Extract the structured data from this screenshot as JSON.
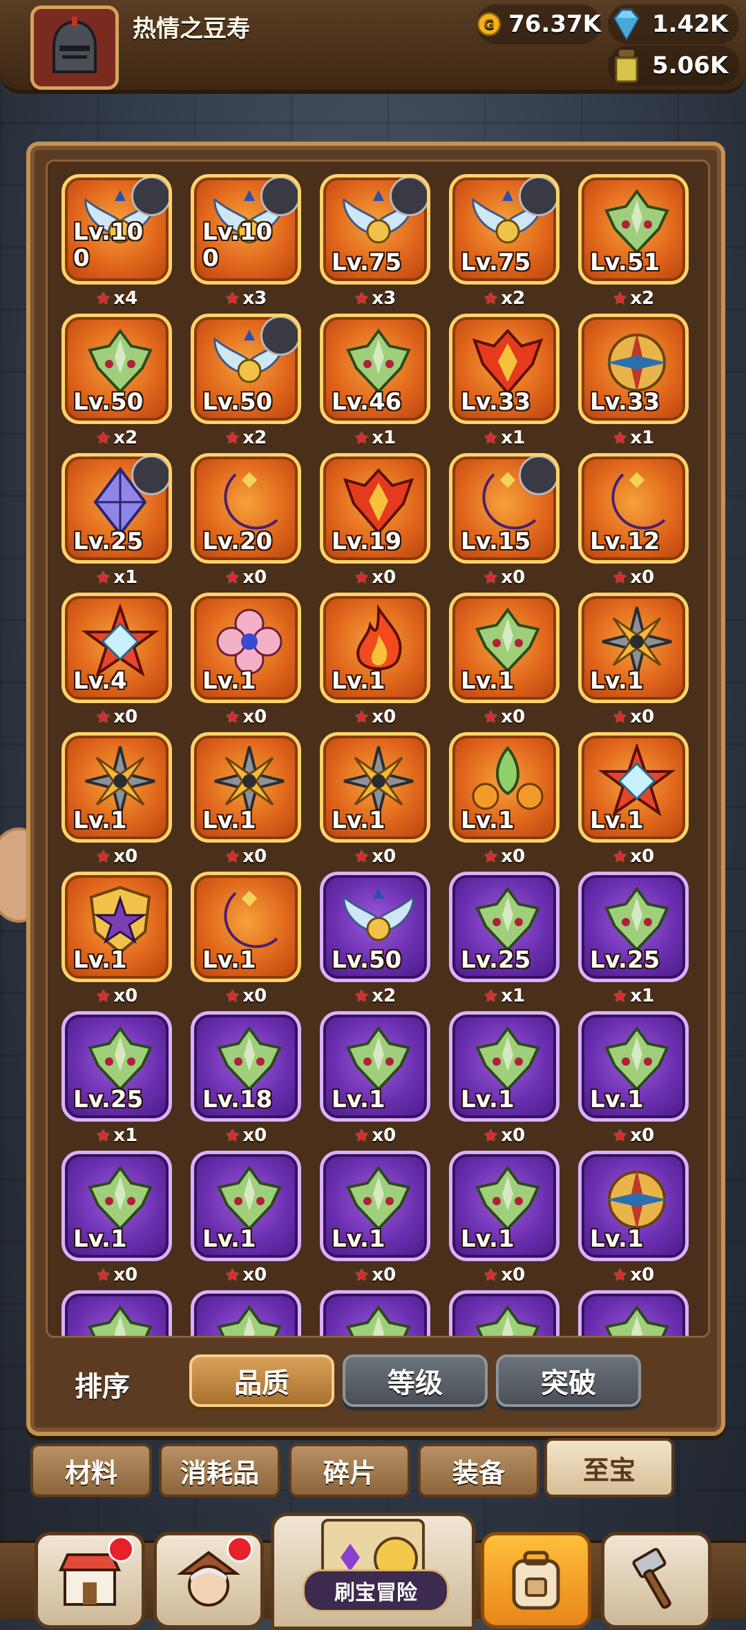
{
  "header": {
    "player_name": "热情之豆寿",
    "resources": {
      "gold": "76.37K",
      "gems": "1.42K",
      "potion": "5.06K"
    }
  },
  "items": [
    {
      "rarity": "orange",
      "icon": "wings-icon",
      "level": "Lv.10\n0",
      "count": "x4",
      "hero": true
    },
    {
      "rarity": "orange",
      "icon": "wings-icon",
      "level": "Lv.10\n0",
      "count": "x3",
      "hero": true
    },
    {
      "rarity": "orange",
      "icon": "wings-icon",
      "level": "Lv.75",
      "count": "x3",
      "hero": true
    },
    {
      "rarity": "orange",
      "icon": "wings-icon",
      "level": "Lv.75",
      "count": "x2",
      "hero": true
    },
    {
      "rarity": "orange",
      "icon": "dragon-head-icon",
      "level": "Lv.51",
      "count": "x2",
      "hero": false
    },
    {
      "rarity": "orange",
      "icon": "dragon-head-icon",
      "level": "Lv.50",
      "count": "x2",
      "hero": false
    },
    {
      "rarity": "orange",
      "icon": "wings-icon",
      "level": "Lv.50",
      "count": "x2",
      "hero": true
    },
    {
      "rarity": "orange",
      "icon": "dragon-head-icon",
      "level": "Lv.46",
      "count": "x1",
      "hero": false
    },
    {
      "rarity": "orange",
      "icon": "flame-mask-icon",
      "level": "Lv.33",
      "count": "x1",
      "hero": false
    },
    {
      "rarity": "orange",
      "icon": "compass-emblem-icon",
      "level": "Lv.33",
      "count": "x1",
      "hero": false
    },
    {
      "rarity": "orange",
      "icon": "crystal-icon",
      "level": "Lv.25",
      "count": "x1",
      "hero": true
    },
    {
      "rarity": "orange",
      "icon": "crescent-moon-icon",
      "level": "Lv.20",
      "count": "x0",
      "hero": false
    },
    {
      "rarity": "orange",
      "icon": "flame-mask-icon",
      "level": "Lv.19",
      "count": "x0",
      "hero": false
    },
    {
      "rarity": "orange",
      "icon": "crescent-moon-icon",
      "level": "Lv.15",
      "count": "x0",
      "hero": true
    },
    {
      "rarity": "orange",
      "icon": "crescent-moon-icon",
      "level": "Lv.12",
      "count": "x0",
      "hero": false
    },
    {
      "rarity": "orange",
      "icon": "star-diamond-icon",
      "level": "Lv.4",
      "count": "x0",
      "hero": false
    },
    {
      "rarity": "orange",
      "icon": "flower-icon",
      "level": "Lv.1",
      "count": "x0",
      "hero": false
    },
    {
      "rarity": "orange",
      "icon": "fire-icon",
      "level": "Lv.1",
      "count": "x0",
      "hero": false
    },
    {
      "rarity": "orange",
      "icon": "dragon-head-icon",
      "level": "Lv.1",
      "count": "x0",
      "hero": false
    },
    {
      "rarity": "orange",
      "icon": "shuriken-icon",
      "level": "Lv.1",
      "count": "x0",
      "hero": false
    },
    {
      "rarity": "orange",
      "icon": "shuriken-icon",
      "level": "Lv.1",
      "count": "x0",
      "hero": false
    },
    {
      "rarity": "orange",
      "icon": "shuriken-icon",
      "level": "Lv.1",
      "count": "x0",
      "hero": false
    },
    {
      "rarity": "orange",
      "icon": "shuriken-icon",
      "level": "Lv.1",
      "count": "x0",
      "hero": false
    },
    {
      "rarity": "orange",
      "icon": "leaf-fruit-icon",
      "level": "Lv.1",
      "count": "x0",
      "hero": false
    },
    {
      "rarity": "orange",
      "icon": "star-diamond-icon",
      "level": "Lv.1",
      "count": "x0",
      "hero": false
    },
    {
      "rarity": "orange",
      "icon": "star-shield-icon",
      "level": "Lv.1",
      "count": "x0",
      "hero": false
    },
    {
      "rarity": "orange",
      "icon": "crescent-moon-icon",
      "level": "Lv.1",
      "count": "x0",
      "hero": false
    },
    {
      "rarity": "purple",
      "icon": "wings-icon",
      "level": "Lv.50",
      "count": "x2",
      "hero": false
    },
    {
      "rarity": "purple",
      "icon": "dragon-head-icon",
      "level": "Lv.25",
      "count": "x1",
      "hero": false
    },
    {
      "rarity": "purple",
      "icon": "dragon-head-icon",
      "level": "Lv.25",
      "count": "x1",
      "hero": false
    },
    {
      "rarity": "purple",
      "icon": "dragon-head-icon",
      "level": "Lv.25",
      "count": "x1",
      "hero": false
    },
    {
      "rarity": "purple",
      "icon": "dragon-head-icon",
      "level": "Lv.18",
      "count": "x0",
      "hero": false
    },
    {
      "rarity": "purple",
      "icon": "dragon-head-icon",
      "level": "Lv.1",
      "count": "x0",
      "hero": false
    },
    {
      "rarity": "purple",
      "icon": "dragon-head-icon",
      "level": "Lv.1",
      "count": "x0",
      "hero": false
    },
    {
      "rarity": "purple",
      "icon": "dragon-head-icon",
      "level": "Lv.1",
      "count": "x0",
      "hero": false
    },
    {
      "rarity": "purple",
      "icon": "dragon-head-icon",
      "level": "Lv.1",
      "count": "x0",
      "hero": false
    },
    {
      "rarity": "purple",
      "icon": "dragon-head-icon",
      "level": "Lv.1",
      "count": "x0",
      "hero": false
    },
    {
      "rarity": "purple",
      "icon": "dragon-head-icon",
      "level": "Lv.1",
      "count": "x0",
      "hero": false
    },
    {
      "rarity": "purple",
      "icon": "dragon-head-icon",
      "level": "Lv.1",
      "count": "x0",
      "hero": false
    },
    {
      "rarity": "purple",
      "icon": "compass-emblem-icon",
      "level": "Lv.1",
      "count": "x0",
      "hero": false
    },
    {
      "rarity": "purple",
      "icon": "dragon-head-icon",
      "level": "",
      "count": "",
      "hero": false
    },
    {
      "rarity": "purple",
      "icon": "dragon-head-icon",
      "level": "",
      "count": "",
      "hero": false
    },
    {
      "rarity": "purple",
      "icon": "dragon-head-icon",
      "level": "",
      "count": "",
      "hero": false
    },
    {
      "rarity": "purple",
      "icon": "dragon-head-icon",
      "level": "",
      "count": "",
      "hero": false
    },
    {
      "rarity": "purple",
      "icon": "dragon-head-icon",
      "level": "",
      "count": "",
      "hero": false
    }
  ],
  "sort": {
    "label": "排序",
    "buttons": [
      "品质",
      "等级",
      "突破"
    ],
    "active": 0
  },
  "categories": {
    "tabs": [
      "材料",
      "消耗品",
      "碎片",
      "装备",
      "至宝"
    ],
    "active": 4
  },
  "bottom_nav": {
    "center_label": "刷宝冒险",
    "items": [
      "shop-icon",
      "hero-icon",
      "treasure-map-icon",
      "backpack-icon",
      "forge-hammer-icon"
    ],
    "active": 3
  },
  "colors": {
    "orange_tile": "#e0661c",
    "purple_tile": "#6a2fb0",
    "star": "#e4242a",
    "panel": "#5b3c22"
  }
}
